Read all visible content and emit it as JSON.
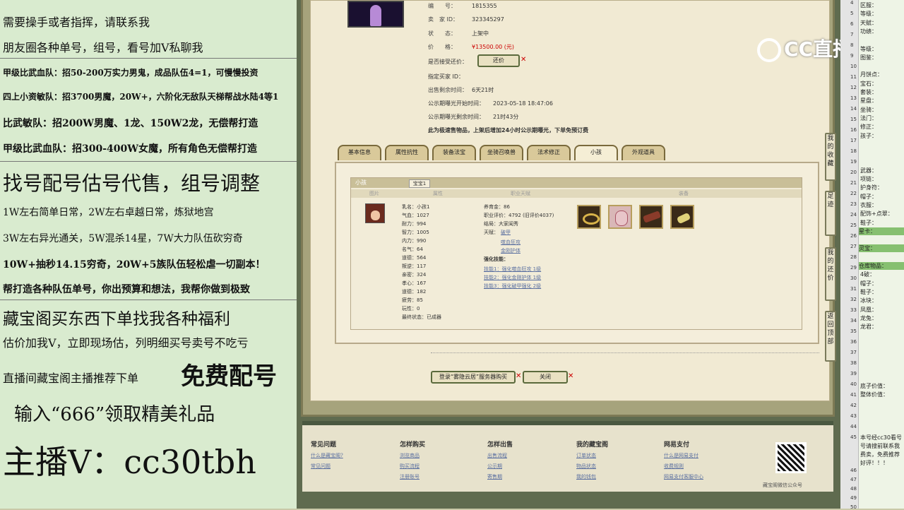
{
  "left_panel": {
    "lines": [
      "需要操手或者指挥，请联系我",
      "朋友圈各种单号，组号，看号加V私聊我",
      "甲级比武血队：招50-200万实力男鬼，成品队伍4=1，可慢慢投资",
      "四上小资敏队：招3700男魔，20W+，六阶化无敌队天梯帮战水陆4等1",
      "比武敏队：招200W男魔、1龙、150W2龙，无偿帮打造",
      "甲级比武血队：招300-400W女魔，所有角色无偿帮打造",
      "找号配号估号代售，组号调整",
      "1W左右简单日常，2W左右卓越日常，炼狱地宫",
      "3W左右异光通关，5W混杀14星，7W大力队伍砍穷奇",
      "10W+抽秒14.15穷奇，20W+5族队伍轻松虐一切副本！",
      "帮打造各种队伍单号，你出预算和想法，我帮你做到极致",
      "藏宝阁买东西下单找我各种福利",
      "估价加我V，立即现场估，列明细买号卖号不吃亏",
      "直播间藏宝阁主播推荐下单",
      "免费配号",
      "输入“666”领取精美礼品",
      "主播V：cc30tbh"
    ]
  },
  "listing": {
    "fields": [
      {
        "label": "编　　号：",
        "value": "1815355"
      },
      {
        "label": "卖　家 ID：",
        "value": "323345297"
      },
      {
        "label": "状　　态：",
        "value": "上架中"
      },
      {
        "label": "价　　格：",
        "value": "¥13500.00 (元)"
      },
      {
        "label": "是否接受还价：",
        "value": ""
      },
      {
        "label": "指定买家 ID：",
        "value": ""
      },
      {
        "label": "出售剩余时间：",
        "value": "6天21时"
      },
      {
        "label": "公示期曝光开始时间：",
        "value": "2023-05-18 18:47:06"
      },
      {
        "label": "公示期曝光剩余时间：",
        "value": "21时43分"
      }
    ],
    "counter_offer_button": "还价",
    "notice": "此为极速售物品，上架后增加24小时公示期曝光，下单免预订费"
  },
  "tabs": [
    "基本信息",
    "属性抗性",
    "装备法宝",
    "坐骑召唤兽",
    "法术修正",
    "小孩",
    "外观道具"
  ],
  "child_panel": {
    "header": "小孩",
    "subtab": "宝宝1",
    "columns": [
      "图片",
      "属性",
      "职业天赋",
      "装备"
    ],
    "stats": [
      "乳名：小孩1",
      "气血：1027",
      "耐力：994",
      "智力：1005",
      "内力：990",
      "名气：64",
      "道德：564",
      "叛逆：117",
      "亲密：324",
      "孝心：167",
      "道德：182",
      "疲劳：85",
      "玩性：0",
      "最终状态：已成器"
    ],
    "mid": {
      "nurture": "养育金：86",
      "rating": "职业评价：4792 (旧评价4037)",
      "ending": "结局：大家闺秀",
      "talent_label": "天赋：",
      "talents": [
        "破甲",
        "噬血狂攻",
        "金刚护体"
      ],
      "skill_label": "强化技能：",
      "skills": [
        "技能1：强化噬血狂攻 1级",
        "技能2：强化金刚护体 1级",
        "技能3：强化破甲强化 2级"
      ]
    }
  },
  "bottom_buttons": {
    "buy": "登录“雾隐云居”服务器购买",
    "close": "关闭"
  },
  "side_buttons": [
    "我的收藏",
    "足迹",
    "我的还价",
    "返回顶部"
  ],
  "footer": {
    "columns": [
      {
        "title": "常见问题",
        "links": [
          "什么是藏宝阁?",
          "常见问题"
        ]
      },
      {
        "title": "怎样购买",
        "links": [
          "浏览商品",
          "购买流程",
          "注册账号"
        ]
      },
      {
        "title": "怎样出售",
        "links": [
          "出售流程",
          "公示期",
          "寄售期"
        ]
      },
      {
        "title": "我的藏宝阁",
        "links": [
          "订单状态",
          "物品状态",
          "我的钱包"
        ]
      },
      {
        "title": "网易支付",
        "links": [
          "什么是网易支付",
          "收费规则",
          "网易支付客服中心"
        ]
      }
    ],
    "qr_caption": "藏宝阁微信公众号"
  },
  "watermark": "CC直播",
  "right_sheet": {
    "numbers": [
      "4",
      "5",
      "6",
      "7",
      "8",
      "9",
      "10",
      "11",
      "12",
      "13",
      "14",
      "15",
      "16",
      "17",
      "18",
      "19",
      "20",
      "21",
      "22",
      "23",
      "24",
      "25",
      "26",
      "27",
      "28",
      "29",
      "30",
      "31",
      "32",
      "33",
      "34",
      "35",
      "36",
      "37",
      "38",
      "39",
      "40",
      "41",
      "42",
      "43",
      "44",
      "45",
      "46",
      "47",
      "48",
      "49",
      "50"
    ],
    "rows": [
      {
        "text": "区服：",
        "hl": false
      },
      {
        "text": "等级：",
        "hl": false
      },
      {
        "text": "天赋：",
        "hl": false
      },
      {
        "text": "功绩：",
        "hl": false
      },
      {
        "text": "",
        "hl": false
      },
      {
        "text": "等级：",
        "hl": false
      },
      {
        "text": "图鉴：",
        "hl": false
      },
      {
        "text": "",
        "hl": false
      },
      {
        "text": "月饼点：",
        "hl": false
      },
      {
        "text": "宝石：",
        "hl": false
      },
      {
        "text": "套装：",
        "hl": false
      },
      {
        "text": "星盘：",
        "hl": false
      },
      {
        "text": "坐骑：",
        "hl": false
      },
      {
        "text": "法门：",
        "hl": false
      },
      {
        "text": "修正：",
        "hl": false
      },
      {
        "text": "孩子：",
        "hl": false
      },
      {
        "text": "",
        "hl": false
      },
      {
        "text": "",
        "hl": false
      },
      {
        "text": "",
        "hl": false
      },
      {
        "text": "武器：",
        "hl": false
      },
      {
        "text": "项链：",
        "hl": false
      },
      {
        "text": "护身符：",
        "hl": false
      },
      {
        "text": "帽子：",
        "hl": false
      },
      {
        "text": "衣服：",
        "hl": false
      },
      {
        "text": "配饰+点翠：",
        "hl": false
      },
      {
        "text": "鞋子：",
        "hl": false
      },
      {
        "text": "星卡：",
        "hl": true
      },
      {
        "text": "",
        "hl": false
      },
      {
        "text": "灵宝：",
        "hl": true
      },
      {
        "text": "",
        "hl": false
      },
      {
        "text": "仓库物品：",
        "hl": true
      },
      {
        "text": "4破：",
        "hl": false
      },
      {
        "text": "帽子：",
        "hl": false
      },
      {
        "text": "鞋子：",
        "hl": false
      },
      {
        "text": "冰块：",
        "hl": false
      },
      {
        "text": "凤凰：",
        "hl": false
      },
      {
        "text": "龙兔：",
        "hl": false
      },
      {
        "text": "龙君：",
        "hl": false
      }
    ],
    "bottom_rows": [
      "底子价值：",
      "整体价值："
    ],
    "note": [
      "本号经cc30看号",
      "号请搜前联系我",
      "费卖，免费推荐",
      "好评！！！"
    ]
  }
}
